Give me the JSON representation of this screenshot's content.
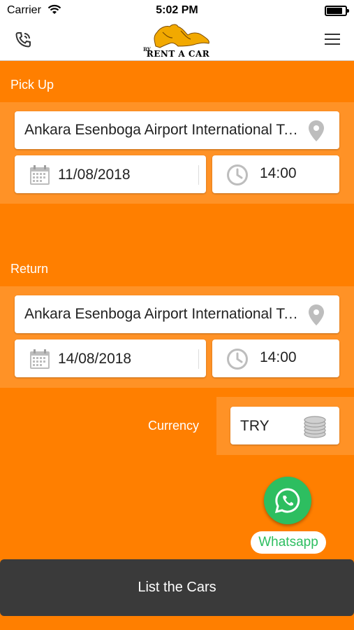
{
  "status_bar": {
    "carrier": "Carrier",
    "time": "5:02 PM"
  },
  "header": {
    "logo_small": "BY",
    "logo_text": "RENT A CAR",
    "phone_icon": "phone-icon",
    "menu_icon": "hamburger-menu-icon"
  },
  "pickup": {
    "label": "Pick Up",
    "location": "Ankara Esenboga Airport International Terminal",
    "date": "11/08/2018",
    "time": "14:00"
  },
  "return": {
    "label": "Return",
    "location": "Ankara Esenboga Airport International Terminal",
    "date": "14/08/2018",
    "time": "14:00"
  },
  "currency": {
    "label": "Currency",
    "value": "TRY"
  },
  "whatsapp": {
    "label": "Whatsapp"
  },
  "list_button": {
    "label": "List the Cars"
  },
  "colors": {
    "background": "#FF7F00",
    "button": "#3A3A3A",
    "whatsapp": "#2DBE60"
  }
}
